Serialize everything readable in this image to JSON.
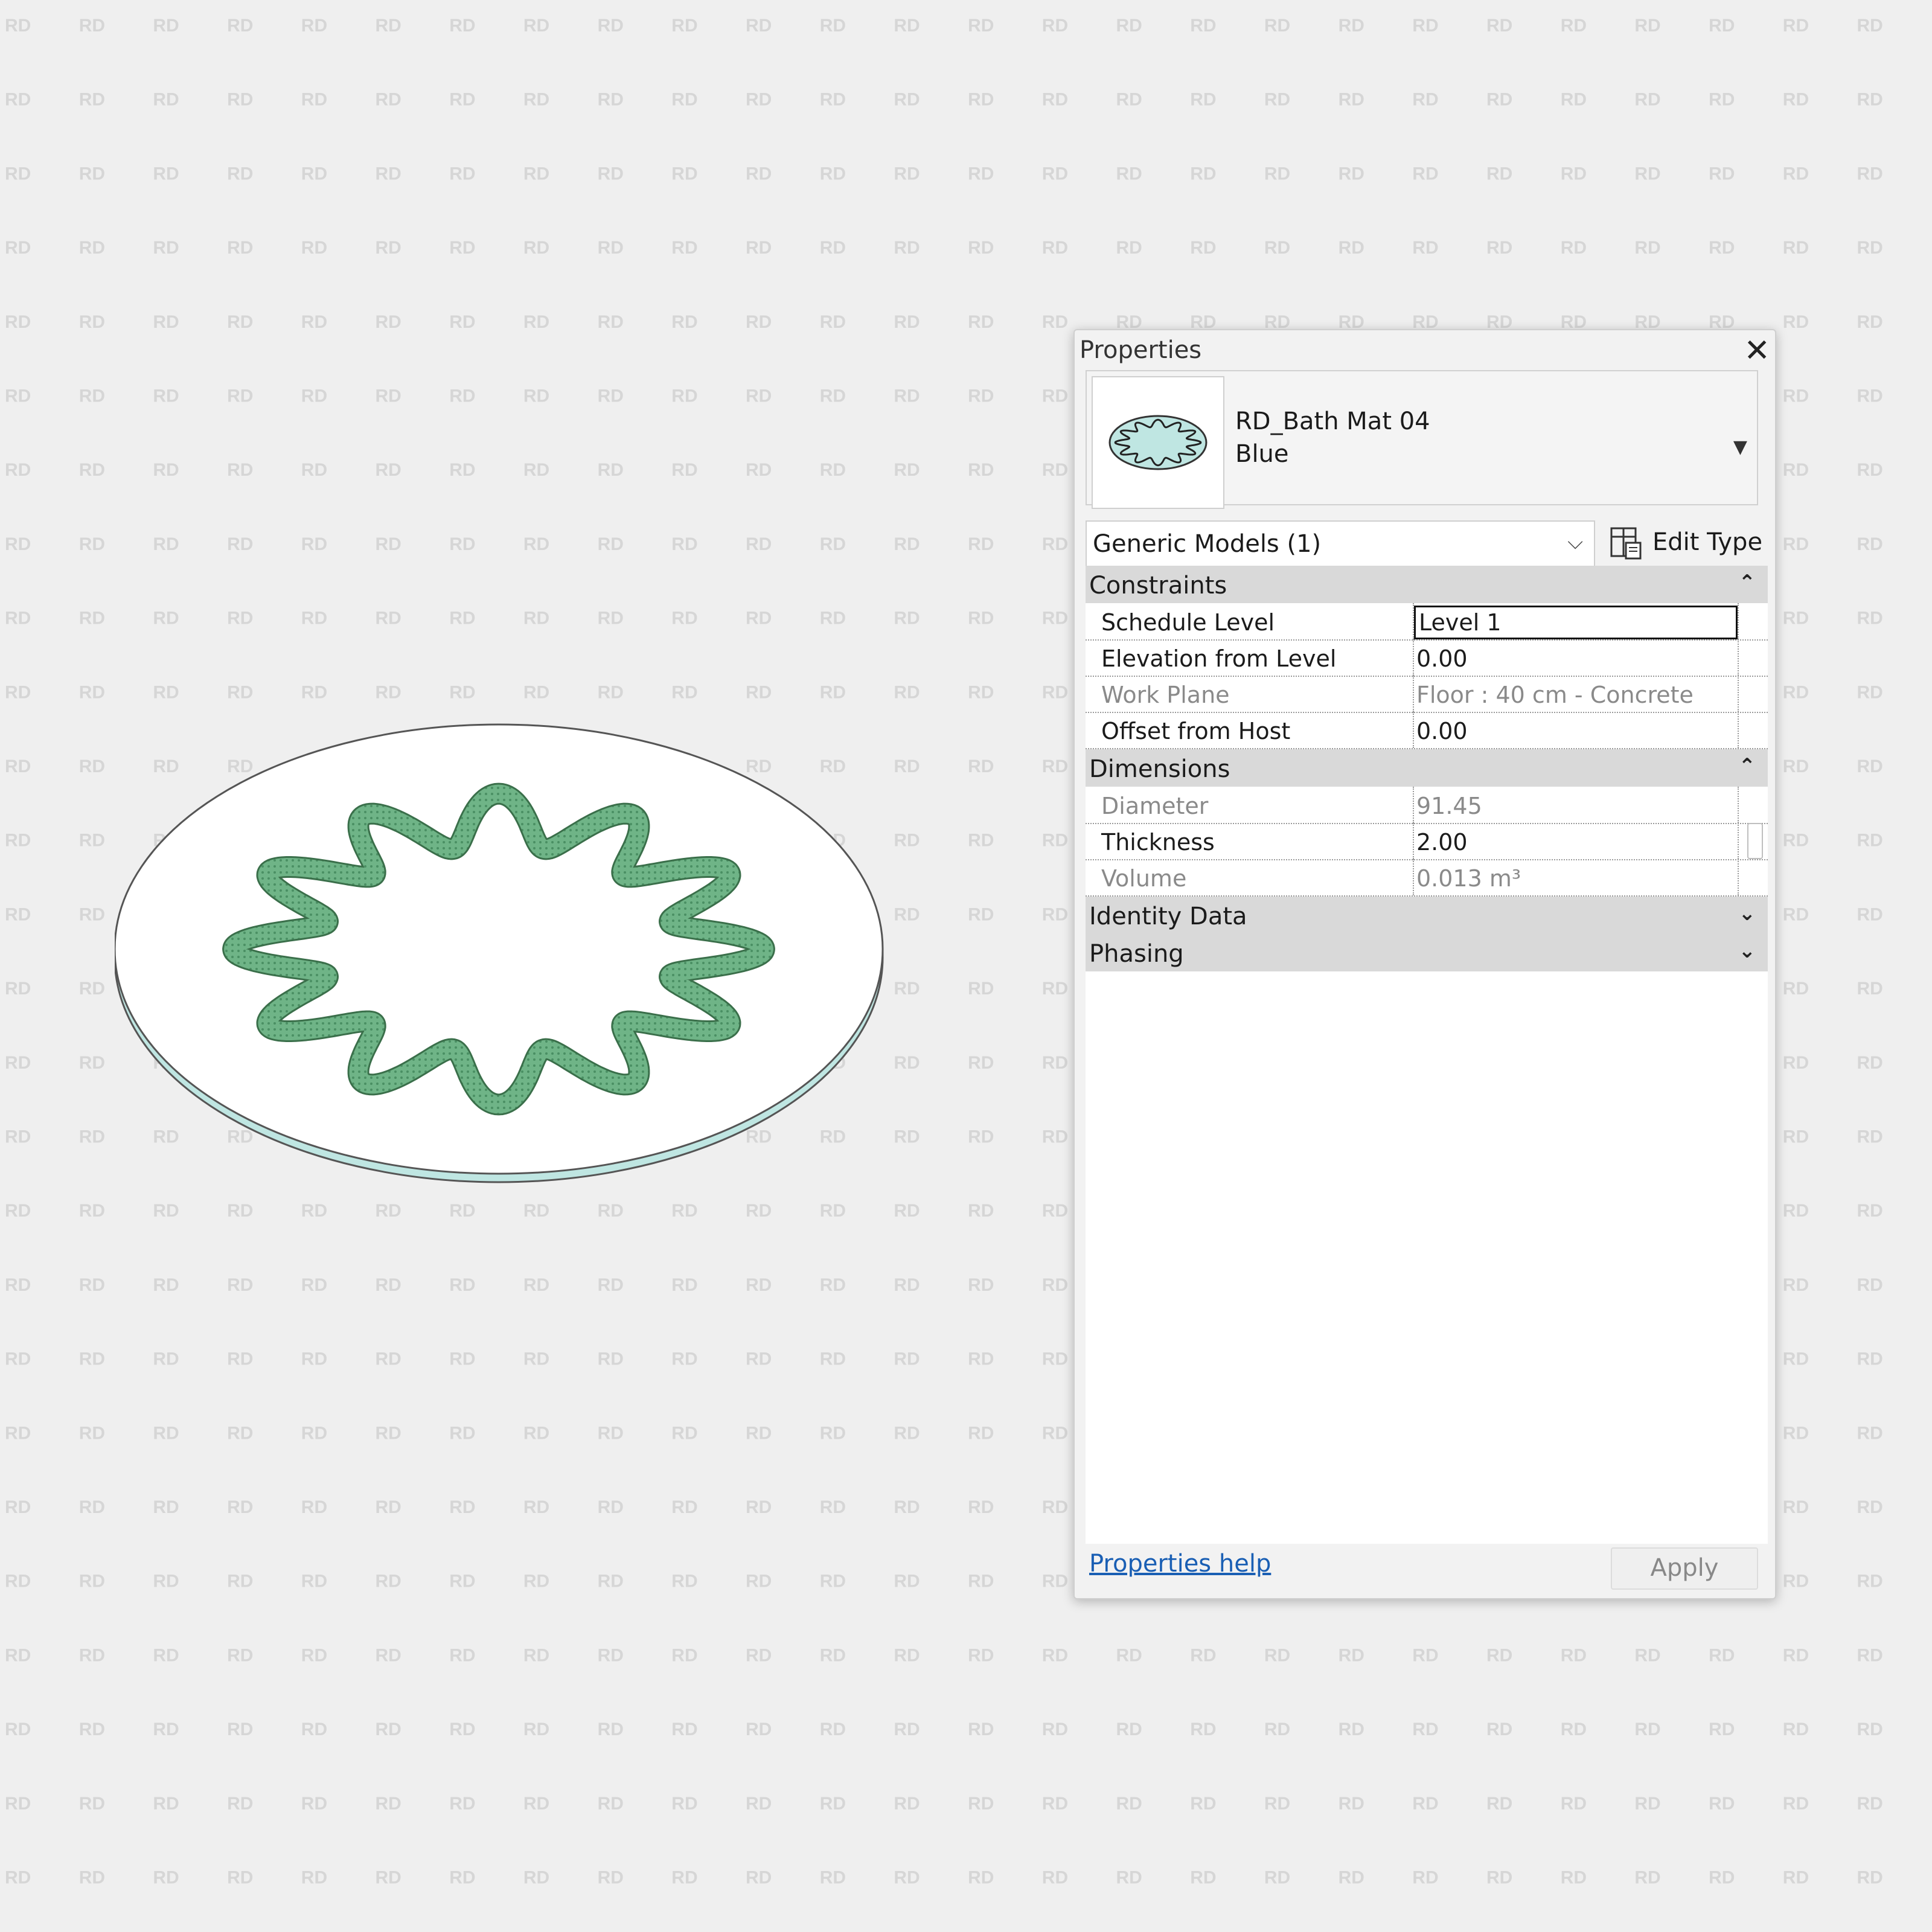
{
  "watermark": "RD",
  "colors": {
    "background": "#efefef",
    "mat_top": "#ffffff",
    "mat_edge": "#bfe6e2",
    "pattern_stroke": "#3a9a5a",
    "pattern_fill": "#6fb487",
    "link": "#1a5fb4"
  },
  "properties": {
    "title": "Properties",
    "close_icon": "close-icon",
    "type_selector": {
      "family": "RD_Bath Mat 04",
      "type": "Blue"
    },
    "category_select": "Generic Models (1)",
    "edit_type_label": "Edit Type",
    "groups": {
      "constraints": "Constraints",
      "dimensions": "Dimensions",
      "identity": "Identity Data",
      "phasing": "Phasing"
    },
    "rows": {
      "schedule_level": {
        "name": "Schedule Level",
        "value": "Level 1"
      },
      "elevation": {
        "name": "Elevation from Level",
        "value": "0.00"
      },
      "work_plane": {
        "name": "Work Plane",
        "value": "Floor : 40 cm - Concrete"
      },
      "offset": {
        "name": "Offset from Host",
        "value": "0.00"
      },
      "diameter": {
        "name": "Diameter",
        "value": "91.45"
      },
      "thickness": {
        "name": "Thickness",
        "value": "2.00"
      },
      "volume": {
        "name": "Volume",
        "value": "0.013 m³"
      }
    },
    "help_link": "Properties help",
    "apply_label": "Apply"
  }
}
